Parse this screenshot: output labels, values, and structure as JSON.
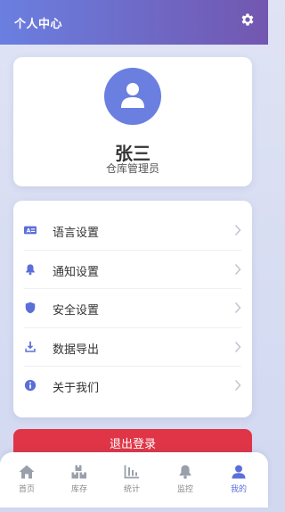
{
  "header": {
    "title": "个人中心",
    "settings_icon": "gear-icon"
  },
  "profile": {
    "name": "张三",
    "role": "仓库管理员",
    "avatar_icon": "user-icon",
    "avatar_color": "#6a7fe0"
  },
  "menu": {
    "items": [
      {
        "label": "语言设置",
        "icon": "language-icon"
      },
      {
        "label": "通知设置",
        "icon": "bell-icon"
      },
      {
        "label": "安全设置",
        "icon": "shield-icon"
      },
      {
        "label": "数据导出",
        "icon": "download-icon"
      },
      {
        "label": "关于我们",
        "icon": "info-icon"
      }
    ]
  },
  "logout": {
    "label": "退出登录",
    "color": "#e03546"
  },
  "tabbar": {
    "tabs": [
      {
        "label": "首页",
        "icon": "home-icon"
      },
      {
        "label": "库存",
        "icon": "boxes-icon"
      },
      {
        "label": "统计",
        "icon": "chart-icon"
      },
      {
        "label": "监控",
        "icon": "bell-icon"
      },
      {
        "label": "我的",
        "icon": "user-icon",
        "active": true
      }
    ],
    "active_color": "#5b6fd8"
  },
  "colors": {
    "accent": "#6a7fe0",
    "header_gradient_end": "#7257b0",
    "danger": "#e03546"
  }
}
